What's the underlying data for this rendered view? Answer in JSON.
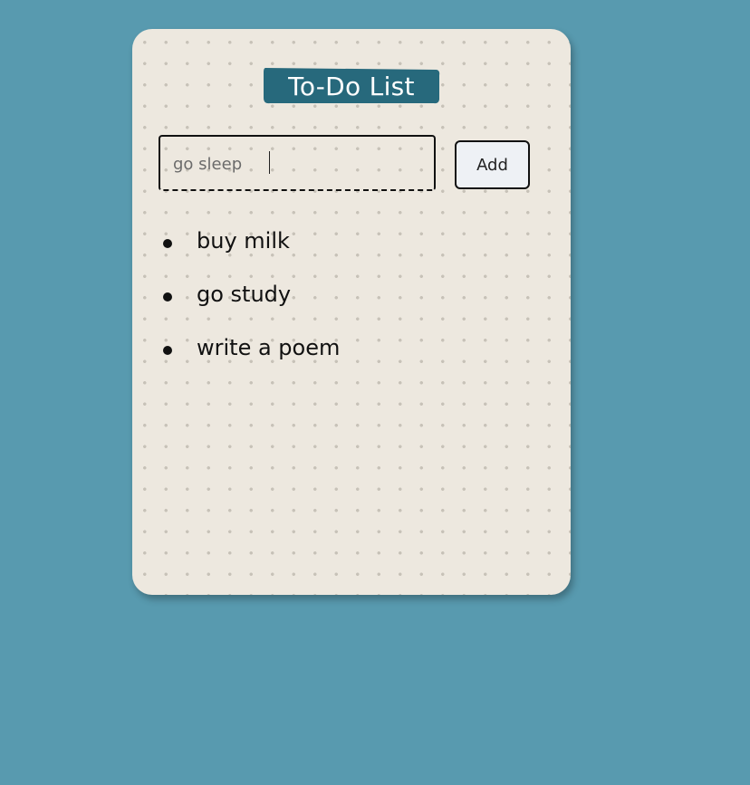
{
  "app": {
    "title": "To-Do List"
  },
  "input": {
    "value": "go sleep",
    "placeholder": ""
  },
  "add_button": {
    "label": "Add"
  },
  "todos": [
    {
      "text": "buy milk"
    },
    {
      "text": "go study"
    },
    {
      "text": "write a poem"
    }
  ],
  "colors": {
    "page_background": "#589aaf",
    "card_background": "#ede8df",
    "title_background": "#27697c",
    "title_text": "#ffffff",
    "button_background": "#eef1f5"
  }
}
